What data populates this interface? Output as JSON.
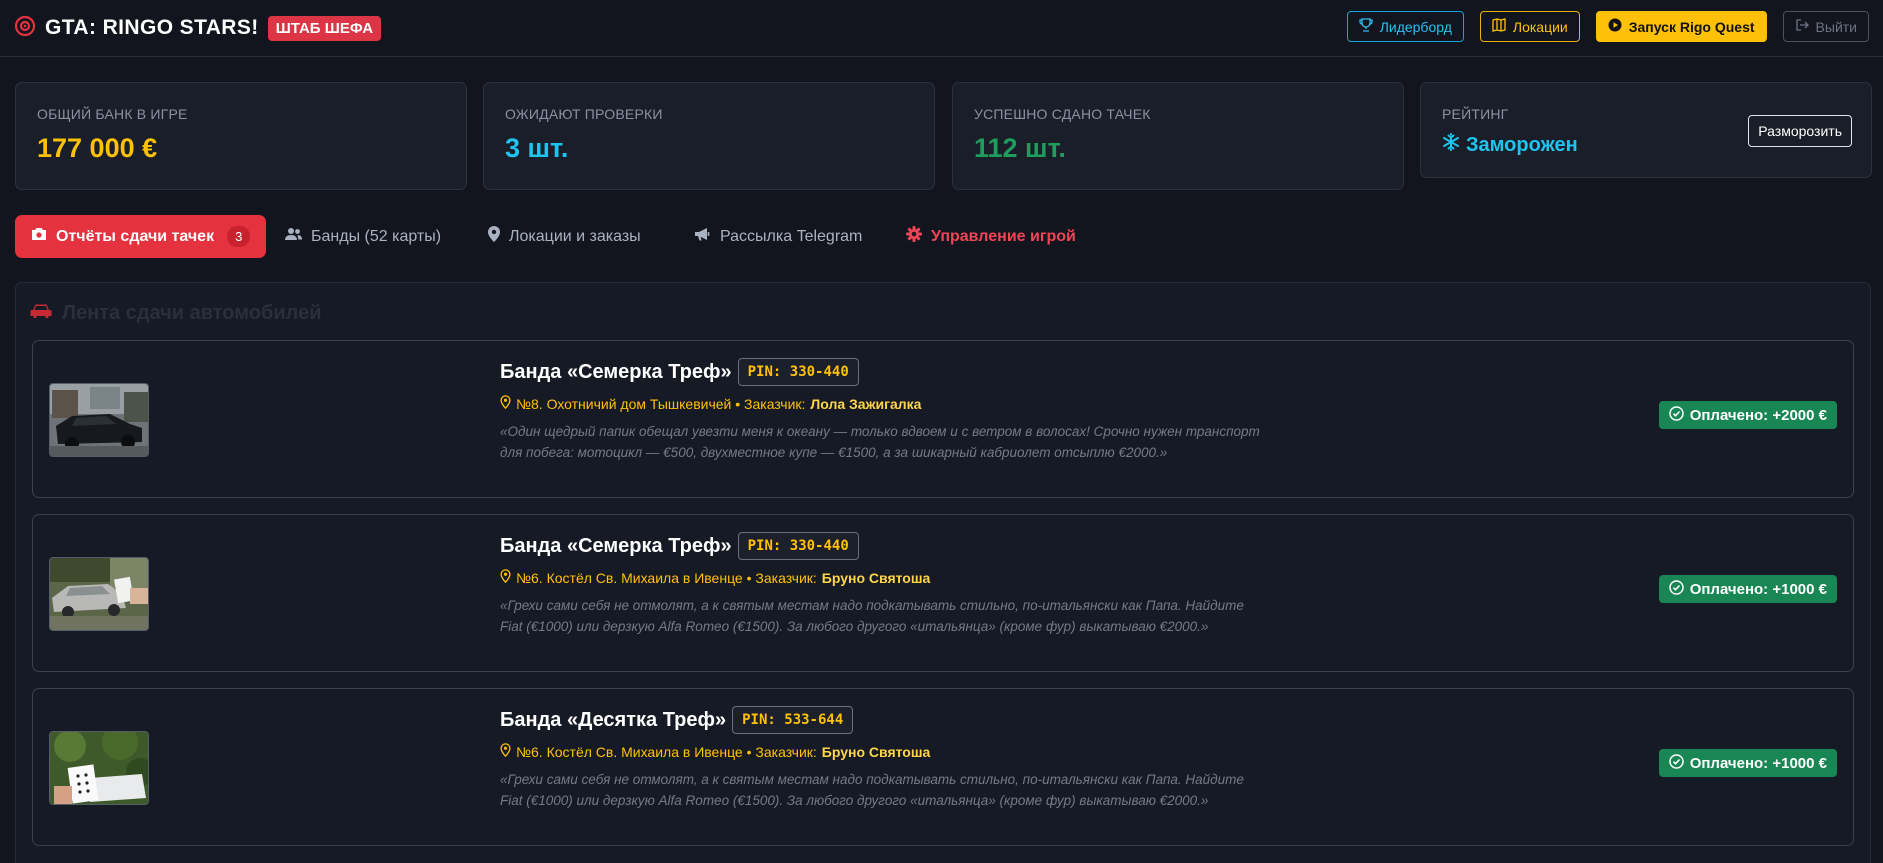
{
  "header": {
    "title": "GTA: RINGO STARS!",
    "badge": "ШТАБ ШЕФА",
    "buttons": {
      "leaderboard": "Лидерборд",
      "locations": "Локации",
      "launch": "Запуск Rigo Quest",
      "logout": "Выйти"
    }
  },
  "stats": [
    {
      "label": "ОБЩИЙ БАНК В ИГРЕ",
      "value": "177 000 €",
      "color": "#ffc107"
    },
    {
      "label": "ОЖИДАЮТ ПРОВЕРКИ",
      "value": "3 шт.",
      "color": "#1fc3f0"
    },
    {
      "label": "УСПЕШНО СДАНО ТАЧЕК",
      "value": "112 шт.",
      "color": "#1f9d5c"
    },
    {
      "label": "РЕЙТИНГ",
      "value": "Заморожен",
      "color": "#1fc3f0",
      "action": "Разморозить"
    }
  ],
  "tabs": [
    {
      "label": "Отчёты сдачи тачек",
      "count": "3",
      "icon": "camera-icon"
    },
    {
      "label": "Банды (52 карты)",
      "icon": "users-icon"
    },
    {
      "label": "Локации и заказы",
      "icon": "map-pin-icon"
    },
    {
      "label": "Рассылка Telegram",
      "icon": "megaphone-icon"
    },
    {
      "label": "Управление игрой",
      "icon": "gear-icon"
    }
  ],
  "feed": {
    "title": "Лента сдачи автомобилей",
    "items": [
      {
        "gang": "Банда «Семерка Треф»",
        "pin": "PIN: 330-440",
        "location": "№8. Охотничий дом Тышкевичей • Заказчик:",
        "customer": "Лола Зажигалка",
        "quote": "«Один щедрый папик обещал увезти меня к океану — только вдвоем и с ветром в волосах! Срочно нужен транспорт для побега: мотоцикл — €500, двухместное купе — €1500, а за шикарный кабриолет отсыплю €2000.»",
        "status": "Оплачено: +2000 €"
      },
      {
        "gang": "Банда «Семерка Треф»",
        "pin": "PIN: 330-440",
        "location": "№6. Костёл Св. Михаила в Ивенце • Заказчик:",
        "customer": "Бруно Святоша",
        "quote": "«Грехи сами себя не отмолят, а к святым местам надо подкатывать стильно, по-итальянски как Папа. Найдите Fiat (€1000) или дерзкую Alfa Romeo (€1500). За любого другого «итальянца» (кроме фур) выкатываю €2000.»",
        "status": "Оплачено: +1000 €"
      },
      {
        "gang": "Банда «Десятка Треф»",
        "pin": "PIN: 533-644",
        "location": "№6. Костёл Св. Михаила в Ивенце • Заказчик:",
        "customer": "Бруно Святоша",
        "quote": "«Грехи сами себя не отмолят, а к святым местам надо подкатывать стильно, по-итальянски как Папа. Найдите Fiat (€1000) или дерзкую Alfa Romeo (€1500). За любого другого «итальянца» (кроме фур) выкатываю €2000.»",
        "status": "Оплачено: +1000 €"
      }
    ]
  }
}
